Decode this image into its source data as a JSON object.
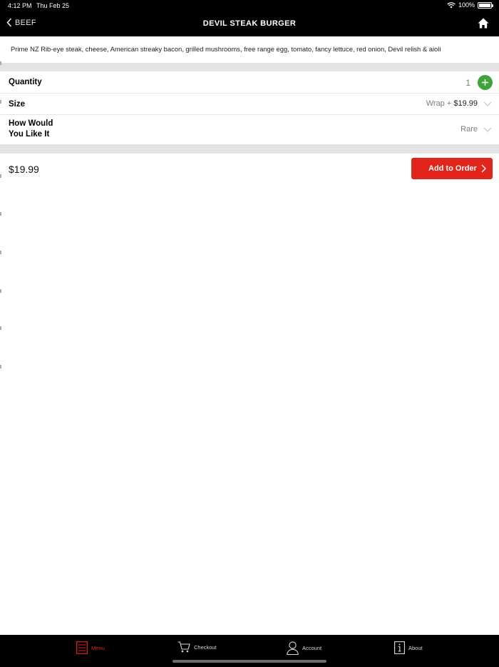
{
  "status": {
    "time": "4:12 PM",
    "date": "Thu Feb 25",
    "battery": "100%"
  },
  "nav": {
    "back_label": "BEEF",
    "title": "DEVIL STEAK BURGER"
  },
  "description": "Prime NZ Rib-eye steak, cheese, American streaky bacon, grilled mushrooms, free range egg, tomato, fancy lettuce, red onion, Devil relish & aioli",
  "options": {
    "quantity": {
      "label": "Quantity",
      "value": "1"
    },
    "size": {
      "label": "Size",
      "value": "Wrap + ",
      "price": "$19.99"
    },
    "cook": {
      "label_line1": "How Would",
      "label_line2": "You Like It",
      "value": "Rare"
    }
  },
  "order": {
    "total": "$19.99",
    "add_label": "Add to Order"
  },
  "tabs": [
    {
      "label": "Menu",
      "icon": "menu-icon"
    },
    {
      "label": "Checkout",
      "icon": "cart-icon"
    },
    {
      "label": "Account",
      "icon": "person-icon"
    },
    {
      "label": "About",
      "icon": "info-icon"
    }
  ],
  "colors": {
    "accent": "#e1251b",
    "plus": "#3da53a",
    "bars": "#000000"
  }
}
